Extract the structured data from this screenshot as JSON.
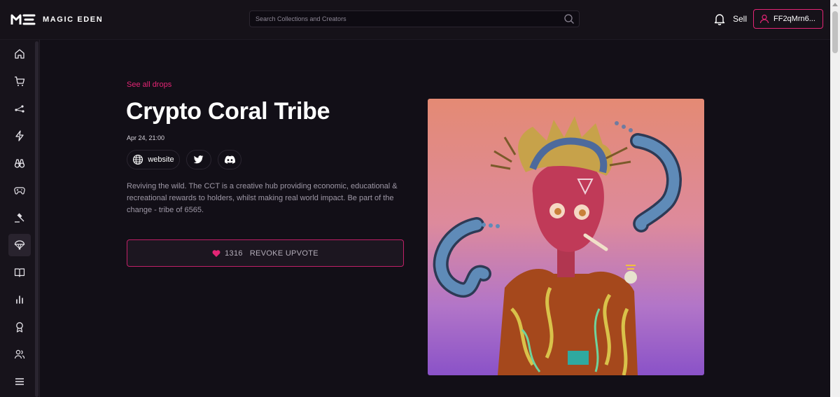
{
  "header": {
    "logo_text": "MAGIC EDEN",
    "search_placeholder": "Search Collections and Creators",
    "sell_label": "Sell",
    "wallet_label": "FF2qMrn6..."
  },
  "sidebar": {
    "items": [
      {
        "icon": "home-icon"
      },
      {
        "icon": "cart-icon"
      },
      {
        "icon": "share-nodes-icon"
      },
      {
        "icon": "lightning-icon"
      },
      {
        "icon": "binoculars-icon"
      },
      {
        "icon": "gamepad-icon"
      },
      {
        "icon": "gavel-icon"
      },
      {
        "icon": "parachute-icon",
        "active": true
      },
      {
        "icon": "book-icon"
      },
      {
        "icon": "bar-chart-icon"
      },
      {
        "icon": "award-icon"
      },
      {
        "icon": "users-icon"
      },
      {
        "icon": "menu-icon"
      }
    ]
  },
  "main": {
    "see_all": "See all drops",
    "title": "Crypto Coral Tribe",
    "date": "Apr 24, 21:00",
    "website_label": "website",
    "description": "Reviving the wild. The CCT is a creative hub providing economic, educational & recreational rewards to holders, whilst making real world impact. Be part of the change - tribe of 6565.",
    "upvote_count": "1316",
    "upvote_label": "REVOKE UPVOTE"
  },
  "colors": {
    "accent": "#e42575",
    "background": "#120f17"
  }
}
